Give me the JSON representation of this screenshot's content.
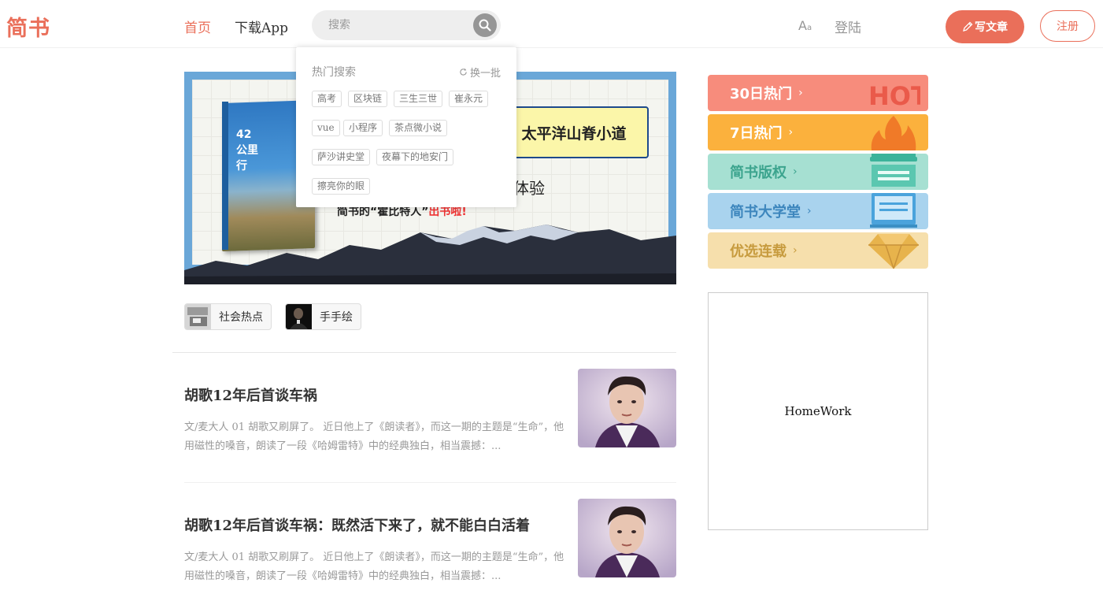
{
  "header": {
    "logo": "简书",
    "nav_home": "首页",
    "nav_app": "下载App",
    "search_placeholder": "搜索",
    "font_toggle": "A",
    "font_toggle_small": "a",
    "login": "登陆",
    "write": "写文章",
    "register": "注册",
    "accent_color": "#ea6f5a"
  },
  "dropdown": {
    "title": "热门搜索",
    "refresh": "换一批",
    "tags": [
      "高考",
      "区块链",
      "三生三世",
      "崔永元",
      "vue",
      "小程序",
      "茶点微小说",
      "萨沙讲史堂",
      "夜幕下的地安门",
      "擦亮你的眼"
    ]
  },
  "banner": {
    "title": "太平洋山脊小道",
    "subtitle": "体验",
    "slogan_prefix": "简书的“霍比特人”",
    "slogan_highlight": "出书啦!",
    "book_title_line1": "42",
    "book_title_line2": "公里",
    "book_title_line3": "行"
  },
  "topics": [
    "社会热点",
    "手手绘"
  ],
  "articles": [
    {
      "title": "胡歌12年后首谈车祸",
      "abstract": "文/麦大人 01 胡歌又刷屏了。 近日他上了《朗读者》，而这一期的主题是“生命”，他用磁性的嗓音，朗读了一段《哈姆雷特》中的经典独白，相当震撼：..."
    },
    {
      "title": "胡歌12年后首谈车祸：既然活下来了，就不能白白活着",
      "abstract": "文/麦大人 01 胡歌又刷屏了。 近日他上了《朗读者》，而这一期的主题是“生命”，他用磁性的嗓音，朗读了一段《哈姆雷特》中的经典独白，相当震撼：..."
    }
  ],
  "sidebar": {
    "boards": [
      {
        "label": "30日热门",
        "color": "#f78c7c",
        "icon": "hot-icon",
        "icon_text": "HOT"
      },
      {
        "label": "7日热门",
        "color": "#fbb13d",
        "icon": "fire-icon"
      },
      {
        "label": "简书版权",
        "color": "#a6e0d2",
        "icon": "typewriter-icon"
      },
      {
        "label": "简书大学堂",
        "color": "#a9d3ee",
        "icon": "screen-icon"
      },
      {
        "label": "优选连载",
        "color": "#f6dfac",
        "icon": "diamond-icon"
      }
    ],
    "homework": "HomeWork"
  }
}
